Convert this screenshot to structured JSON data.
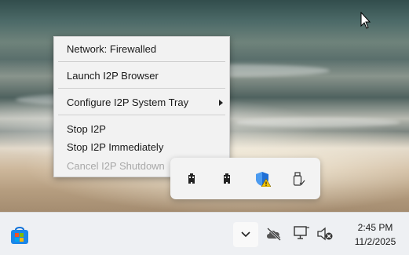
{
  "context_menu": {
    "status": "Network: Firewalled",
    "launch_browser": "Launch I2P Browser",
    "configure_tray": "Configure I2P System Tray",
    "stop": "Stop I2P",
    "stop_immediately": "Stop I2P Immediately",
    "cancel_shutdown": "Cancel I2P Shutdown"
  },
  "tray_overflow": {
    "icons": [
      "i2p-tray-icon",
      "i2p-tray-icon",
      "windows-security-warning-icon",
      "usb-drive-icon"
    ]
  },
  "taskbar": {
    "start_icon": "microsoft-store-icon",
    "show_hidden_icon": "chevron-down-icon",
    "tray_icons": [
      "cloud-offline-icon",
      "network-monitor-icon",
      "speaker-muted-icon"
    ],
    "time": "2:45 PM",
    "date": "11/2/2025"
  },
  "colors": {
    "warning": "#f5c400",
    "shield": "#1f6fd6",
    "store_blue": "#0a6fd8"
  }
}
